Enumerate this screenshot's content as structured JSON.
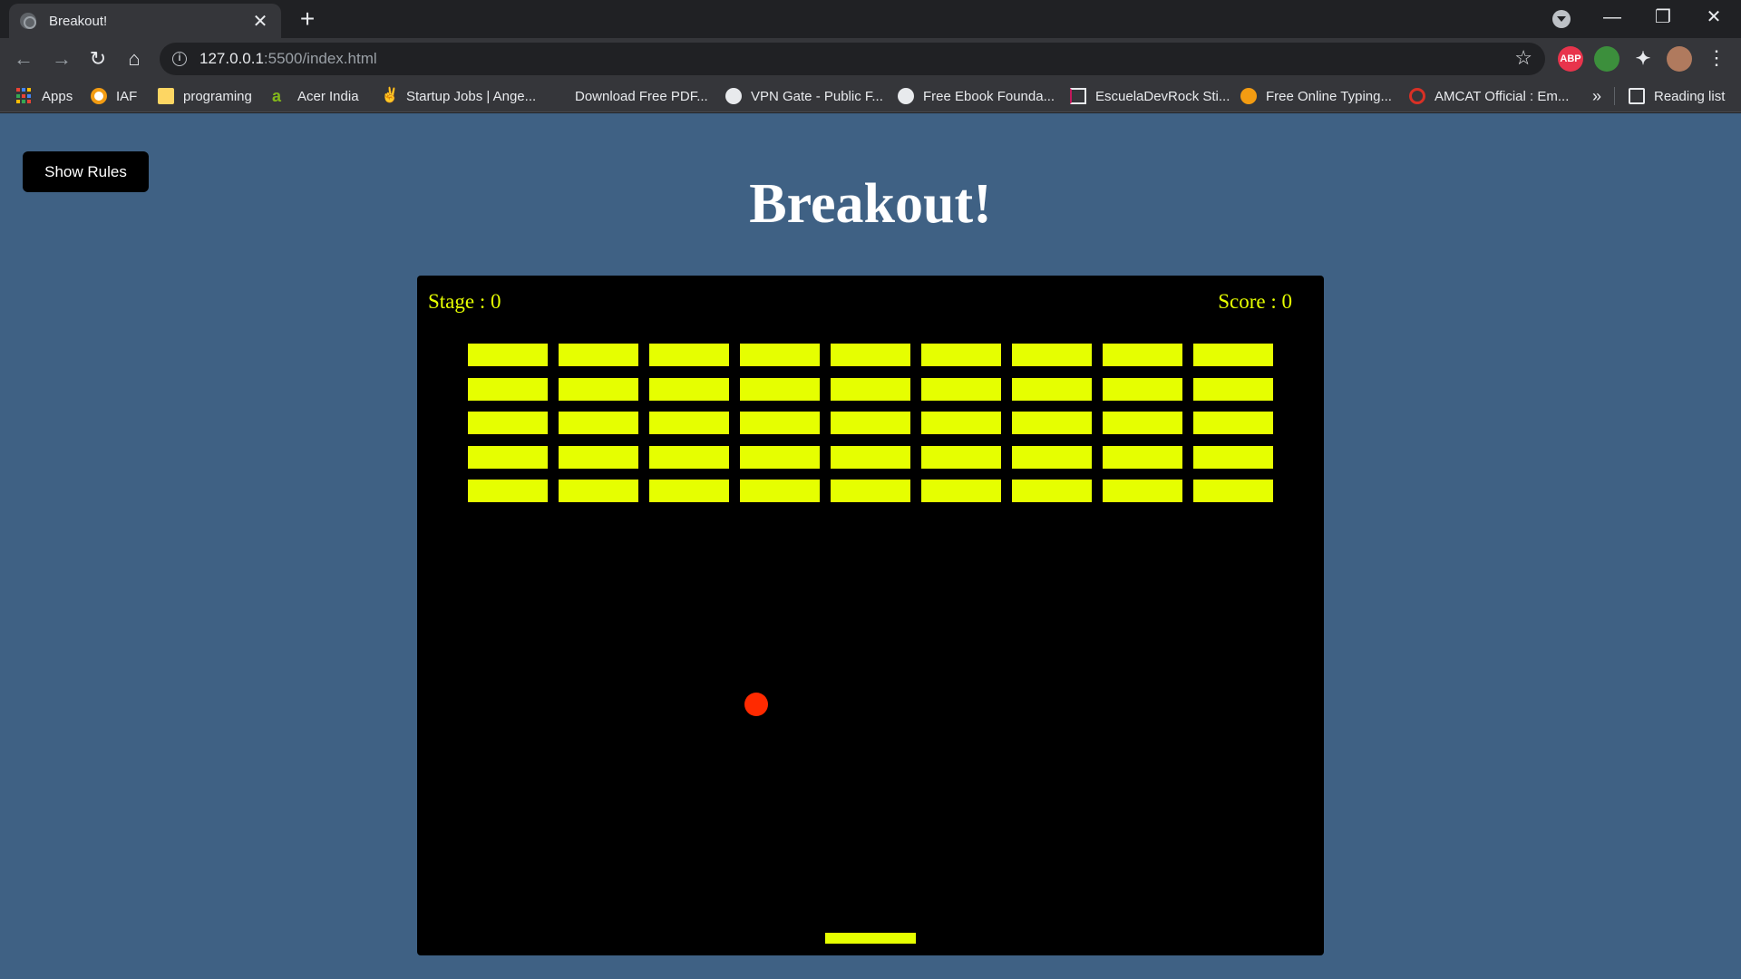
{
  "browser": {
    "tab_title": "Breakout!",
    "tab_close": "✕",
    "new_tab": "+",
    "url_host": "127.0.0.1",
    "url_rest": ":5500/index.html",
    "window_controls": [
      "—",
      "❐",
      "✕"
    ]
  },
  "bookmarks": [
    {
      "label": "Apps",
      "icon": "apps-grid-icon"
    },
    {
      "label": "IAF",
      "icon": "iaf-icon"
    },
    {
      "label": "programing",
      "icon": "folder-icon"
    },
    {
      "label": "Acer India",
      "icon": "acer-icon"
    },
    {
      "label": "Startup Jobs | Ange...",
      "icon": "angellist-icon"
    },
    {
      "label": "Download Free PDF...",
      "icon": "pdf-icon"
    },
    {
      "label": "VPN Gate - Public F...",
      "icon": "globe-icon"
    },
    {
      "label": "Free Ebook Founda...",
      "icon": "github-icon"
    },
    {
      "label": "EscuelaDevRock Sti...",
      "icon": "page-icon"
    },
    {
      "label": "Free Online Typing...",
      "icon": "typing-icon"
    },
    {
      "label": "AMCAT Official : Em...",
      "icon": "amcat-icon"
    }
  ],
  "bookmarks_more": "»",
  "reading_list": "Reading list",
  "extensions": [
    "ABP"
  ],
  "page": {
    "rules_button": "Show Rules",
    "title": "Breakout!",
    "stage_label": "Stage : 0",
    "score_label": "Score : 0"
  },
  "game": {
    "brick_rows": 5,
    "brick_cols": 9,
    "colors": {
      "background": "#3f6184",
      "canvas": "#000000",
      "brick": "#e6ff00",
      "ball": "#ff2a00",
      "paddle": "#e6ff00"
    }
  }
}
